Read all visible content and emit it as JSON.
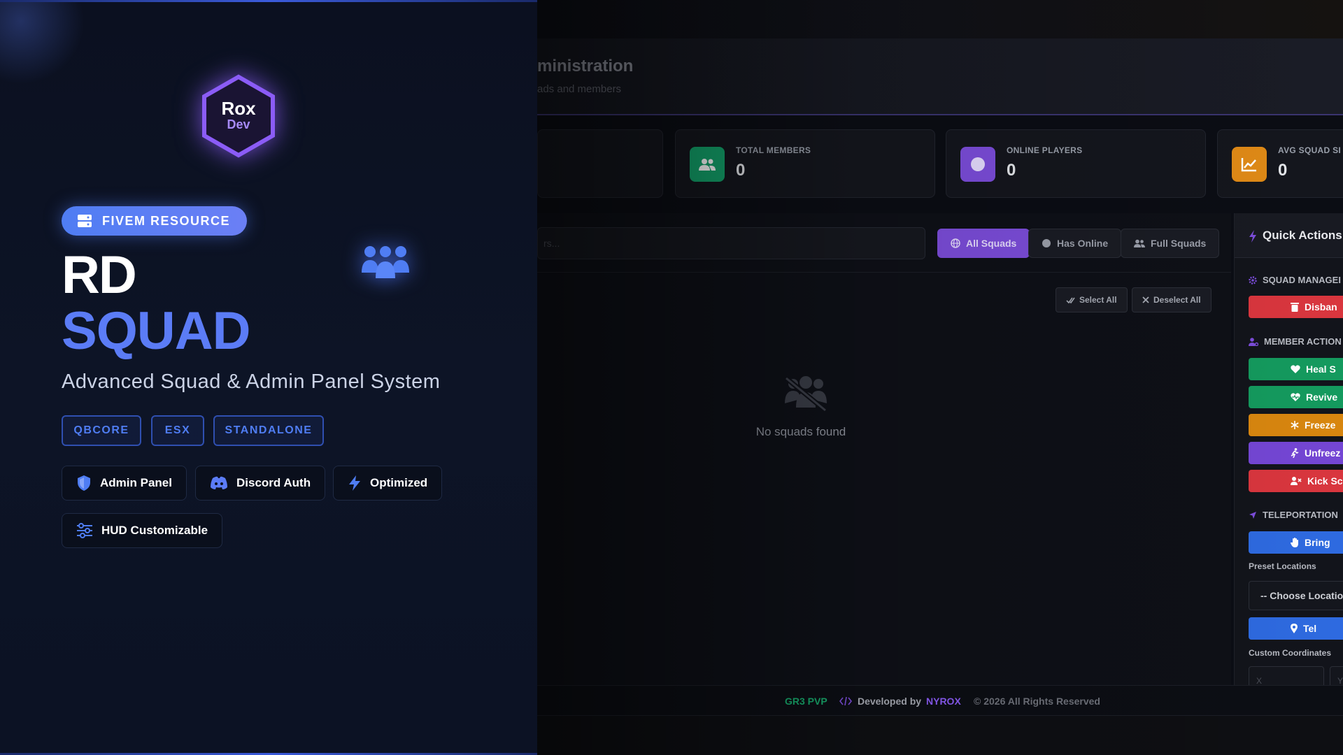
{
  "promo": {
    "logo_line1": "Rox",
    "logo_line2": "Dev",
    "resource_badge": "FIVEM RESOURCE",
    "title_line1": "RD",
    "title_line2": "SQUAD",
    "subtitle": "Advanced Squad & Admin Panel System",
    "frameworks": [
      "QBCORE",
      "ESX",
      "STANDALONE"
    ],
    "features": [
      {
        "label": "Admin Panel",
        "icon": "shield-icon"
      },
      {
        "label": "Discord Auth",
        "icon": "discord-icon"
      },
      {
        "label": "Optimized",
        "icon": "bolt-icon"
      },
      {
        "label": "HUD Customizable",
        "icon": "sliders-icon"
      }
    ],
    "colors": {
      "accent": "#5b7cf6",
      "badge": "#4f7df3",
      "logo_glow": "#8b5cf6"
    }
  },
  "app": {
    "header": {
      "title": "ministration",
      "subtitle": "ads and members"
    },
    "stats": [
      {
        "label": "TOTAL MEMBERS",
        "value": "0",
        "icon": "users-icon",
        "color": "#13a36b"
      },
      {
        "label": "ONLINE PLAYERS",
        "value": "0",
        "icon": "circle-icon",
        "color": "#7c4ddb"
      },
      {
        "label": "AVG SQUAD SI",
        "value": "0",
        "icon": "chart-icon",
        "color": "#e08a16"
      }
    ],
    "search": {
      "placeholder": "rs..."
    },
    "filters": [
      {
        "label": "All Squads",
        "icon": "globe-icon",
        "active": true
      },
      {
        "label": "Has Online",
        "icon": "circle-icon",
        "active": false
      },
      {
        "label": "Full Squads",
        "icon": "users-icon",
        "active": false
      }
    ],
    "select_all": "Select All",
    "deselect_all": "Deselect All",
    "empty_text": "No squads found",
    "quick_actions": {
      "title": "Quick Actions",
      "sections": {
        "squad_management": "SQUAD MANAGEI",
        "member_actions": "MEMBER ACTION",
        "teleportation": "TELEPORTATION"
      },
      "buttons": {
        "disband": "Disban",
        "heal": "Heal S",
        "revive": "Revive",
        "freeze": "Freeze",
        "unfreeze": "Unfreez",
        "kick": "Kick Sc",
        "bring": "Bring",
        "teleport": "Tel"
      },
      "preset_label": "Preset Locations",
      "location_select": "-- Choose Locatio",
      "custom_label": "Custom Coordinates",
      "coord_x": "X",
      "coord_y": "Y"
    },
    "footer": {
      "server": "GR3 PVP",
      "developed_by": "Developed by",
      "developer": "NYROX",
      "copyright": "© 2026 All Rights Reserved"
    }
  }
}
